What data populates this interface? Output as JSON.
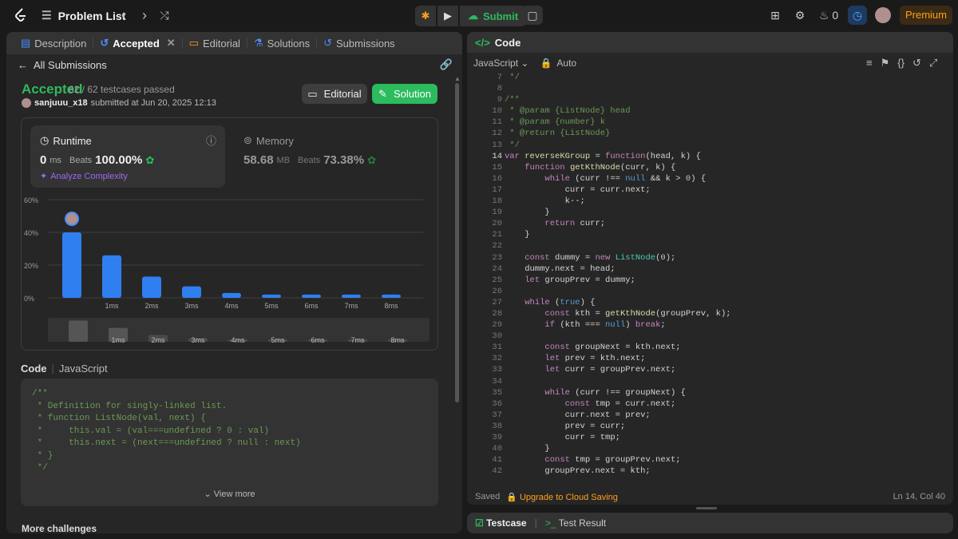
{
  "topbar": {
    "problem_list": "Problem List",
    "submit": "Submit",
    "streak": "0",
    "premium": "Premium"
  },
  "left_tabs": [
    {
      "label": "Description"
    },
    {
      "label": "Accepted"
    },
    {
      "label": "Editorial"
    },
    {
      "label": "Solutions"
    },
    {
      "label": "Submissions"
    }
  ],
  "all_submissions": "All Submissions",
  "result": {
    "status": "Accepted",
    "passed": "62 / 62 testcases passed",
    "user": "sanjuuu_x18",
    "submitted": "submitted at Jun 20, 2025 12:13",
    "editorial_btn": "Editorial",
    "solution_btn": "Solution"
  },
  "runtime": {
    "label": "Runtime",
    "value": "0",
    "unit": "ms",
    "beats_label": "Beats",
    "beats": "100.00%",
    "analyze": "Analyze Complexity"
  },
  "memory": {
    "label": "Memory",
    "value": "58.68",
    "unit": "MB",
    "beats_label": "Beats",
    "beats": "73.38%"
  },
  "chart_data": {
    "type": "bar",
    "categories": [
      "0ms",
      "1ms",
      "2ms",
      "3ms",
      "4ms",
      "5ms",
      "6ms",
      "7ms",
      "8ms"
    ],
    "tick_labels": [
      "",
      "1ms",
      "2ms",
      "3ms",
      "4ms",
      "5ms",
      "6ms",
      "7ms",
      "8ms"
    ],
    "values": [
      40,
      26,
      13,
      7,
      3,
      2,
      2,
      2,
      2
    ],
    "yticks": [
      "60%",
      "40%",
      "20%",
      "0%"
    ],
    "ylim": [
      0,
      60
    ],
    "color": "#2f7ff0",
    "mini_tick_labels": [
      "",
      "1ms",
      "2ms",
      "3ms",
      "4ms",
      "5ms",
      "6ms",
      "7ms",
      "8ms"
    ]
  },
  "code_section": {
    "title": "Code",
    "lang": "JavaScript",
    "snippet": "/**\n * Definition for singly-linked list.\n * function ListNode(val, next) {\n *     this.val = (val===undefined ? 0 : val)\n *     this.next = (next===undefined ? null : next)\n * }\n */",
    "view_more": "View more"
  },
  "more_challenges": "More challenges",
  "editor": {
    "tab": "Code",
    "lang": "JavaScript",
    "auto": "Auto",
    "saved": "Saved",
    "cloud": "Upgrade to Cloud Saving",
    "cursor": "Ln 14, Col 40"
  },
  "code_lines": [
    {
      "n": "7",
      "t": " */"
    },
    {
      "n": "8",
      "t": ""
    },
    {
      "n": "9",
      "t": "/**"
    },
    {
      "n": "10",
      "t": " * @param {ListNode} head"
    },
    {
      "n": "11",
      "t": " * @param {number} k"
    },
    {
      "n": "12",
      "t": " * @return {ListNode}"
    },
    {
      "n": "13",
      "t": " */"
    },
    {
      "n": "14",
      "t": "var reverseKGroup = function(head, k) {"
    },
    {
      "n": "15",
      "t": "    function getKthNode(curr, k) {"
    },
    {
      "n": "16",
      "t": "        while (curr !== null && k > 0) {"
    },
    {
      "n": "17",
      "t": "            curr = curr.next;"
    },
    {
      "n": "18",
      "t": "            k--;"
    },
    {
      "n": "19",
      "t": "        }"
    },
    {
      "n": "20",
      "t": "        return curr;"
    },
    {
      "n": "21",
      "t": "    }"
    },
    {
      "n": "22",
      "t": ""
    },
    {
      "n": "23",
      "t": "    const dummy = new ListNode(0);"
    },
    {
      "n": "24",
      "t": "    dummy.next = head;"
    },
    {
      "n": "25",
      "t": "    let groupPrev = dummy;"
    },
    {
      "n": "26",
      "t": ""
    },
    {
      "n": "27",
      "t": "    while (true) {"
    },
    {
      "n": "28",
      "t": "        const kth = getKthNode(groupPrev, k);"
    },
    {
      "n": "29",
      "t": "        if (kth === null) break;"
    },
    {
      "n": "30",
      "t": ""
    },
    {
      "n": "31",
      "t": "        const groupNext = kth.next;"
    },
    {
      "n": "32",
      "t": "        let prev = kth.next;"
    },
    {
      "n": "33",
      "t": "        let curr = groupPrev.next;"
    },
    {
      "n": "34",
      "t": ""
    },
    {
      "n": "35",
      "t": "        while (curr !== groupNext) {"
    },
    {
      "n": "36",
      "t": "            const tmp = curr.next;"
    },
    {
      "n": "37",
      "t": "            curr.next = prev;"
    },
    {
      "n": "38",
      "t": "            prev = curr;"
    },
    {
      "n": "39",
      "t": "            curr = tmp;"
    },
    {
      "n": "40",
      "t": "        }"
    },
    {
      "n": "41",
      "t": "        const tmp = groupPrev.next;"
    },
    {
      "n": "42",
      "t": "        groupPrev.next = kth;"
    }
  ],
  "bottom_tabs": {
    "testcase": "Testcase",
    "result": "Test Result"
  }
}
